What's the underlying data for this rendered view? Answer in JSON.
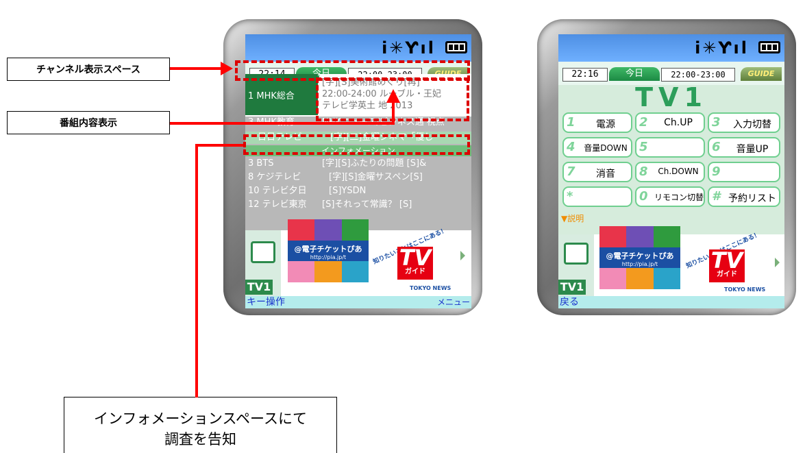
{
  "callouts": {
    "channel_space": "チャンネル表示スペース",
    "program_content": "番組内容表示",
    "info_space_line1": "インフォメーションスペースにて",
    "info_space_line2": "調査を告知"
  },
  "left_phone": {
    "time": "22:14",
    "today": "今日",
    "range": "22:00-23:00",
    "guide": "GUIDE",
    "current_channel": "1  MHK総合",
    "current_program": [
      "[字][S]美術館めぐり[再]",
      "22:00-24:00  ルーブル・王妃",
      "テレビ学英土 地    2013"
    ],
    "rows_above": [
      {
        "channel": "3  MHK教育",
        "program": "NHKニュース/ビジネス通 視点"
      }
    ],
    "info_row": {
      "channel": "日日テレビ",
      "program": "[字][二]金曜シネマ「優し"
    },
    "info_band": "インフォメーション",
    "rows": [
      {
        "channel": "3  BTS",
        "program": "[字][S]ふたりの問題  [S]&"
      },
      {
        "channel": "8  ケジテレビ",
        "program": "[字][S]金曜サスペン[S]"
      },
      {
        "channel": "10 テレビ夕日",
        "program": "[S]YSDN"
      },
      {
        "channel": "12 テレビ東京",
        "program": "[S]それって常識？  [S]"
      }
    ],
    "tv_label": "TV1",
    "soft_left": "キー操作",
    "soft_right": "メニュー"
  },
  "ads": {
    "pia_name": "@電子チケットぴあ",
    "pia_url": "http://pia.jp/t",
    "slogan": "知りたいことはここにある！",
    "tv": "TV",
    "guide_kana": "ガイド",
    "tokyo_news": "TOKYO NEWS"
  },
  "right_phone": {
    "time": "22:16",
    "today": "今日",
    "range": "22:00-23:00",
    "guide": "GUIDE",
    "title": "TV1",
    "keys": [
      {
        "num": "1",
        "label": "電源"
      },
      {
        "num": "2",
        "label": "Ch.UP"
      },
      {
        "num": "3",
        "label": "入力切替"
      },
      {
        "num": "4",
        "label": "音量DOWN"
      },
      {
        "num": "5",
        "label": ""
      },
      {
        "num": "6",
        "label": "音量UP"
      },
      {
        "num": "7",
        "label": "消音"
      },
      {
        "num": "8",
        "label": "Ch.DOWN"
      },
      {
        "num": "9",
        "label": ""
      },
      {
        "num": "*",
        "label": ""
      },
      {
        "num": "0",
        "label": "リモコン切替"
      },
      {
        "num": "#",
        "label": "予約リスト"
      }
    ],
    "explain": "▼説明",
    "tv_label": "TV1",
    "soft_left": "戻る"
  },
  "colors": {
    "highlight": "#ff0000",
    "channel_green": "#1f7a3e",
    "softkey_bg": "#b4ecec"
  }
}
